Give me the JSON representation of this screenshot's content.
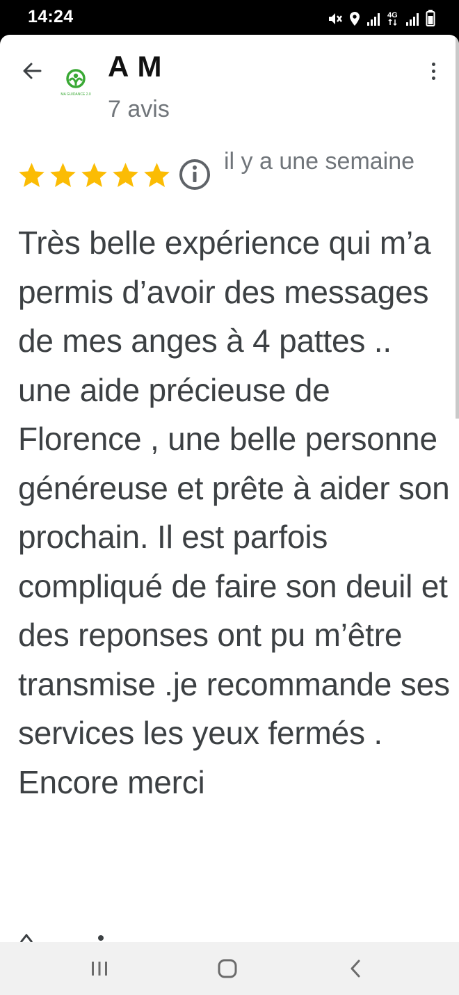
{
  "status_bar": {
    "time": "14:24",
    "icons": [
      "mute-icon",
      "location-icon",
      "signal-icon",
      "network-4g-icon",
      "signal-icon",
      "battery-icon"
    ],
    "network_label": "4G"
  },
  "header": {
    "back_icon": "arrow-left-icon",
    "reviewer_name": "A M",
    "review_count": "7 avis",
    "avatar_text": "MA GUIDANCE 2.0",
    "avatar_color": "#3aa935",
    "more_icon": "more-vertical-icon"
  },
  "review": {
    "rating": 5,
    "max_rating": 5,
    "star_color": "#fbbc04",
    "info_icon": "info-icon",
    "time": "il y a une semaine",
    "text": "Très belle expérience qui m’a permis d’avoir des messages de mes anges à 4 pattes .. une aide précieuse de Florence , une belle personne généreuse  et prête à aider son prochain. Il est parfois compliqué de faire son deuil et des reponses ont pu m’être transmise .je recommande ses services les yeux fermés . Encore merci"
  },
  "nav_bar": {
    "buttons": [
      "recents-icon",
      "home-icon",
      "back-icon"
    ]
  },
  "colors": {
    "text_primary": "#3c4043",
    "text_secondary": "#70757a",
    "sheet_bg": "#ffffff",
    "nav_bg": "#f1f1f1"
  }
}
